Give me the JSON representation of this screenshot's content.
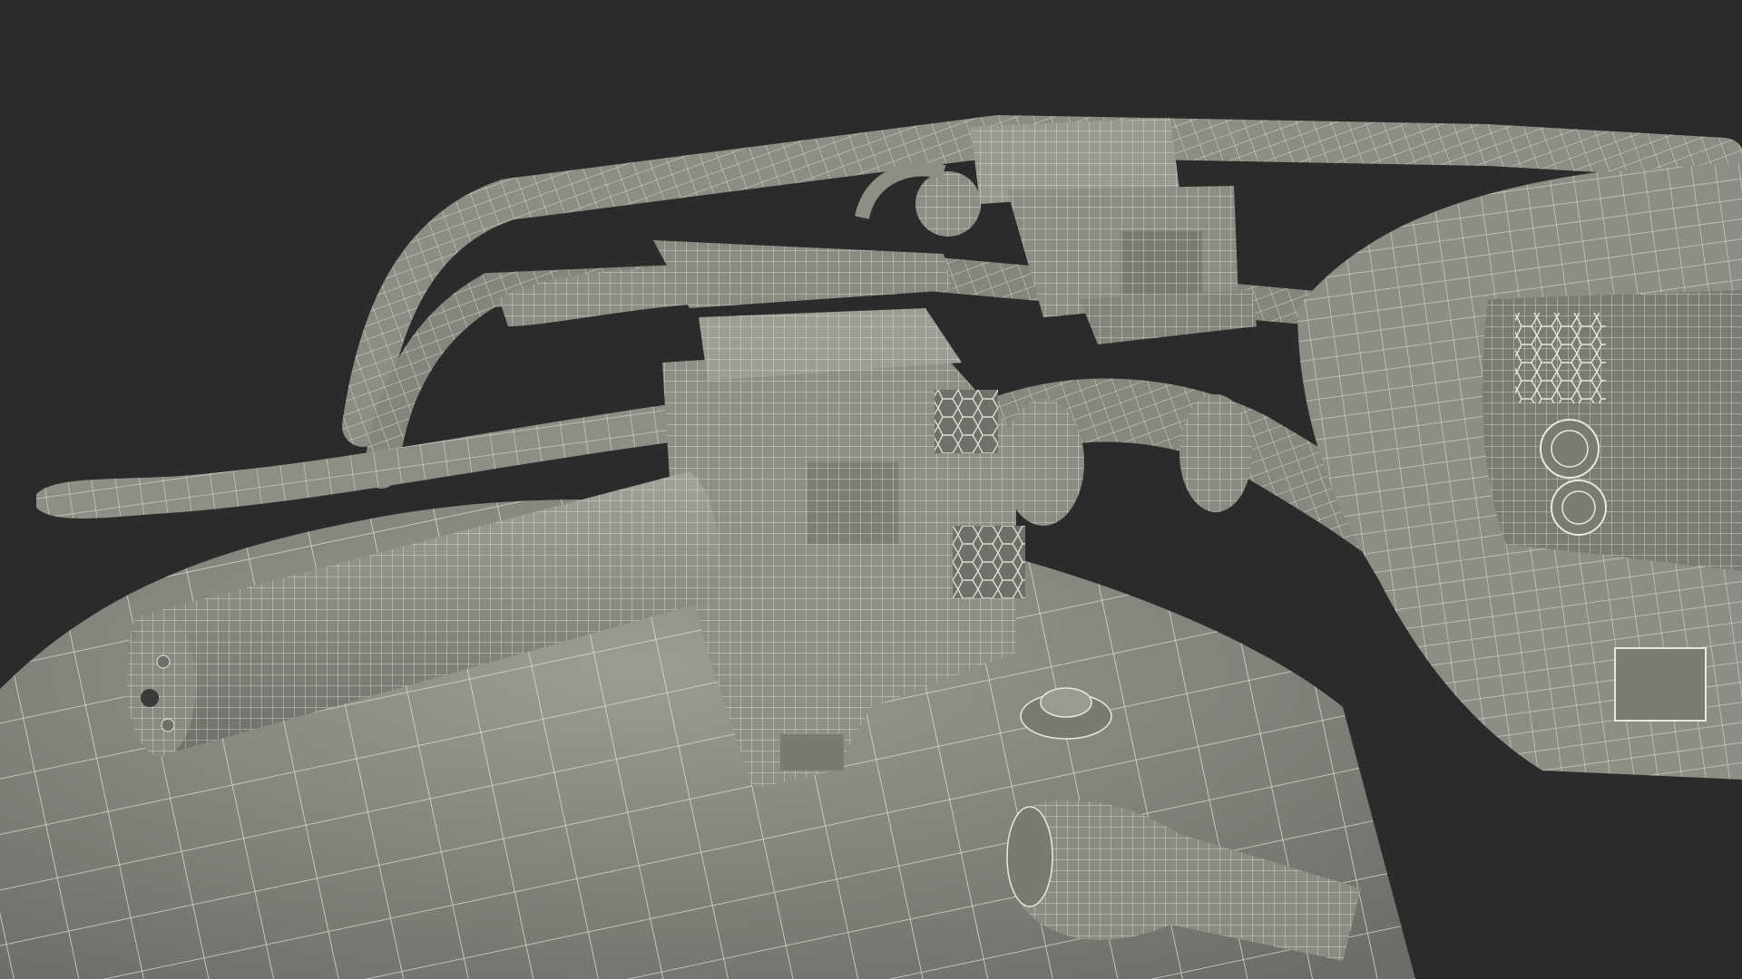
{
  "image": {
    "kind": "3d-wireframe-render",
    "colors": {
      "background": "#2a2b2b",
      "surface": "#8f8f86",
      "surface_dark": "#6f706a",
      "surface_light": "#a4a49b",
      "wire": "#e8e8de",
      "shadow": "#3a3b38"
    }
  }
}
